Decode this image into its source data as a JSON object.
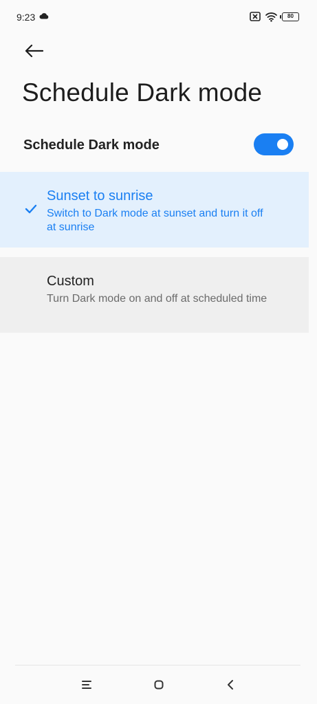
{
  "status_bar": {
    "time": "9:23",
    "weather_icon": "cloud-icon",
    "sim_icon": "no-sim-icon",
    "wifi_icon": "wifi-icon",
    "battery_level": "80"
  },
  "header": {
    "back_icon": "arrow-left-icon",
    "title": "Schedule Dark mode"
  },
  "schedule_toggle": {
    "label": "Schedule Dark mode",
    "enabled": true,
    "accent_color": "#1a7ff2"
  },
  "options": [
    {
      "title": "Sunset to sunrise",
      "description": "Switch to Dark mode at sunset and turn it off at sunrise",
      "selected": true
    },
    {
      "title": "Custom",
      "description": "Turn Dark mode on and off at scheduled time",
      "selected": false
    }
  ],
  "nav_bar": {
    "menu_icon": "menu-icon",
    "home_icon": "home-icon",
    "back_icon": "back-chevron-icon"
  }
}
